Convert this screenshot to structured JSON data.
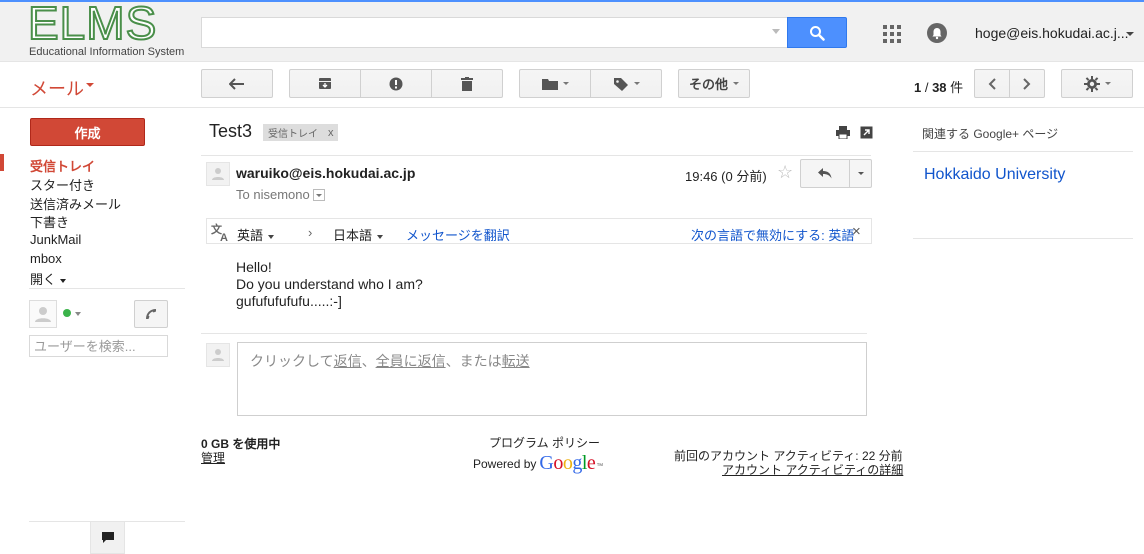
{
  "header": {
    "logo_text": "ELMS",
    "logo_subtitle": "Educational Information System",
    "search": {
      "value": "",
      "placeholder": ""
    },
    "account": "hoge@eis.hokudai.ac.j..."
  },
  "toolbar": {
    "mail_label": "メール",
    "more_label": "その他",
    "pager_range": "1",
    "pager_total": "38",
    "pager_unit": "件"
  },
  "nav": {
    "compose_label": "作成",
    "items": [
      {
        "label": "受信トレイ",
        "active": true
      },
      {
        "label": "スター付き"
      },
      {
        "label": "送信済みメール"
      },
      {
        "label": "下書き"
      },
      {
        "label": "JunkMail"
      },
      {
        "label": "mbox"
      },
      {
        "label": "開く"
      }
    ],
    "user_search_placeholder": "ユーザーを検索..."
  },
  "message": {
    "subject": "Test3",
    "tag": "受信トレイ",
    "tag_close": "x",
    "sender": "waruiko@eis.hokudai.ac.jp",
    "to": "To nisemono",
    "time": "19:46 (0 分前)",
    "star": "☆",
    "body": "Hello!\nDo you understand who I am?\ngufufufufufu.....:-]"
  },
  "translate": {
    "source_lang": "英語",
    "arrow": "›",
    "target_lang": "日本語",
    "translate_link": "メッセージを翻訳",
    "disable_link": "次の言語で無効にする: 英語",
    "close": "×"
  },
  "reply_prompt": {
    "prefix": "クリックして",
    "reply": "返信",
    "sep1": "、",
    "reply_all": "全員に返信",
    "sep2": "、または",
    "forward": "転送"
  },
  "footer": {
    "storage": "0 GB を使用中",
    "manage": "管理",
    "policy": "プログラム ポリシー",
    "powered_by": "Powered by",
    "google": "Google",
    "tm": "™",
    "activity": "前回のアカウント アクティビティ: 22 分前",
    "activity_link": "アカウント アクティビティの詳細"
  },
  "right_panel": {
    "title": "関連する Google+ ページ",
    "page_link": "Hokkaido University"
  },
  "colors": {
    "accent_red": "#d14836",
    "accent_blue": "#4d90fe",
    "link_blue": "#1155cc",
    "logo_green": "#4a8f4a"
  },
  "icons": [
    "search-icon",
    "apps-grid-icon",
    "notifications-icon",
    "back-arrow-icon",
    "archive-icon",
    "report-spam-icon",
    "trash-icon",
    "folder-icon",
    "label-icon",
    "chevron-left-icon",
    "chevron-right-icon",
    "gear-icon",
    "print-icon",
    "new-window-icon",
    "reply-icon",
    "translate-icon",
    "phone-icon",
    "chat-icon",
    "avatar-icon"
  ]
}
